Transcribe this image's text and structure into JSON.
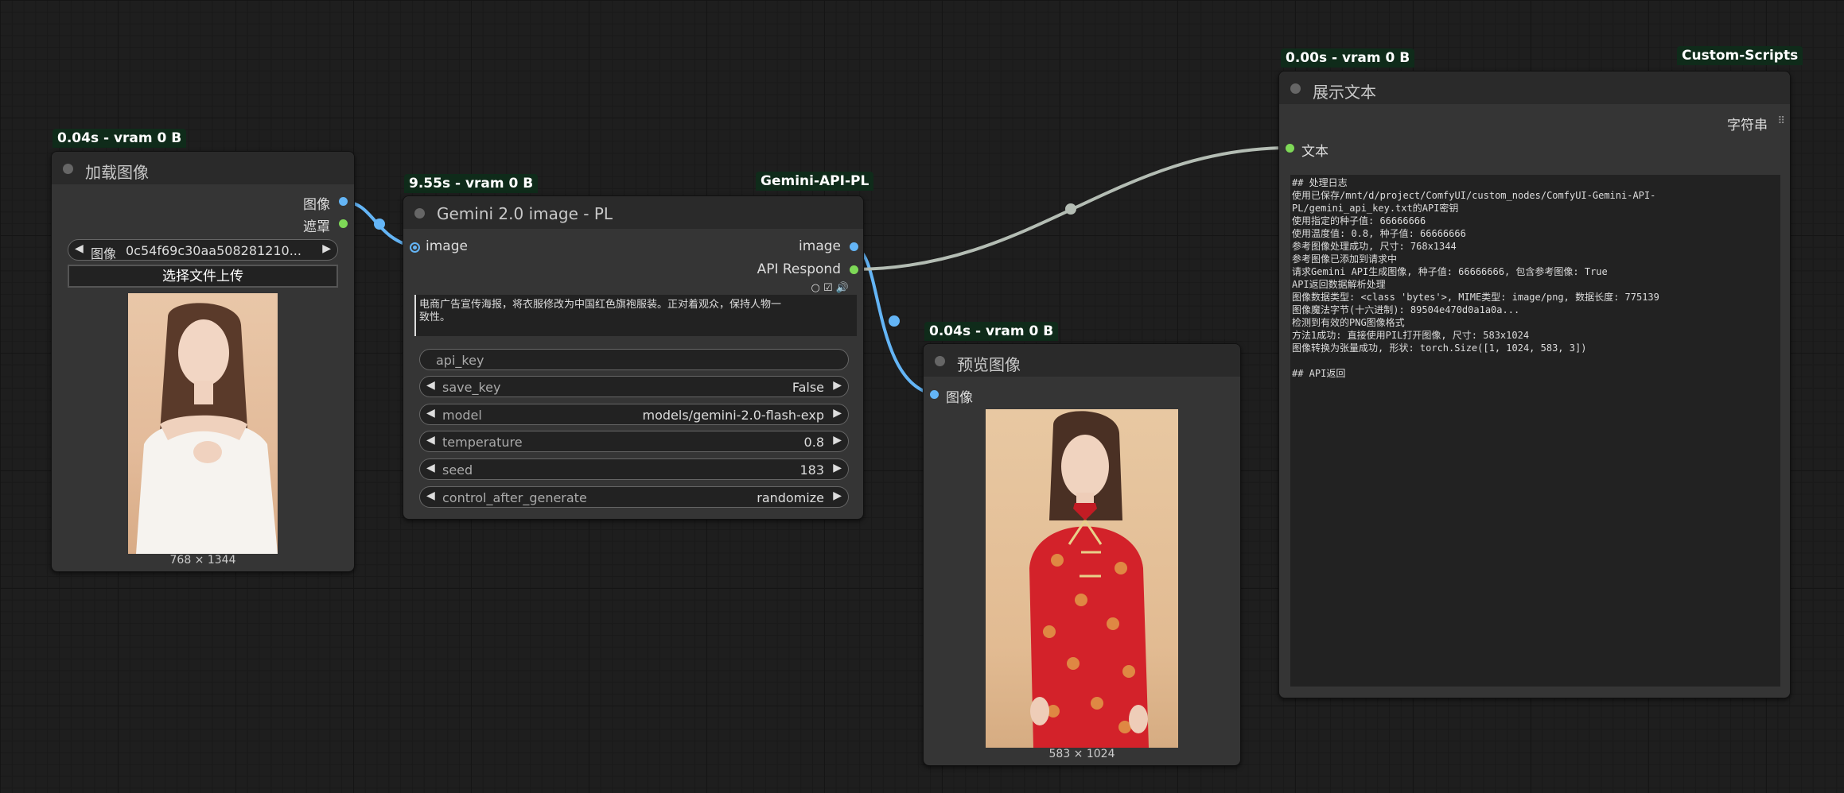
{
  "colors": {
    "canvas": "#1e1e1e",
    "node": "#353535",
    "header": "#2a2a2a",
    "badge": "#0f2b1a",
    "link_image": "#64b5f6",
    "link_string": "#b4bdb4",
    "port_green": "#7ed957"
  },
  "load_image_node": {
    "badge": "0.04s - vram 0 B",
    "title": "加载图像",
    "outputs": [
      "图像",
      "遮罩"
    ],
    "image_widget": {
      "label": "图像",
      "value": "0c54f69c30aa508281210..."
    },
    "upload_button": "选择文件上传",
    "image_desc": "woman-white-sweater-photo",
    "dimensions": "768 × 1344"
  },
  "gemini_node": {
    "badge": "9.55s - vram 0 B",
    "group_label": "Gemini-API-PL",
    "title": "Gemini 2.0 image - PL",
    "input": "image",
    "outputs": [
      "image",
      "API Respond"
    ],
    "prompt": "电商广告宣传海报，将衣服修改为中国红色旗袍服装。正对着观众，保持人物一\n致性。",
    "api_key_placeholder": "api_key",
    "widgets": [
      {
        "label": "save_key",
        "value": "False"
      },
      {
        "label": "model",
        "value": "models/gemini-2.0-flash-exp"
      },
      {
        "label": "temperature",
        "value": "0.8"
      },
      {
        "label": "seed",
        "value": "183"
      },
      {
        "label": "control_after_generate",
        "value": "randomize"
      }
    ]
  },
  "preview_node": {
    "badge": "0.04s - vram 0 B",
    "title": "预览图像",
    "input": "图像",
    "image_desc": "woman-red-qipao-photo",
    "dimensions": "583 × 1024"
  },
  "show_text_node": {
    "badge": "0.00s - vram 0 B",
    "group_label": "Custom-Scripts",
    "title": "展示文本",
    "output": "字符串",
    "input": "文本",
    "text": "## 处理日志\n使用已保存/mnt/d/project/ComfyUI/custom_nodes/ComfyUI-Gemini-API-\nPL/gemini_api_key.txt的API密钥\n使用指定的种子值: 66666666\n使用温度值: 0.8, 种子值: 66666666\n参考图像处理成功, 尺寸: 768x1344\n参考图像已添加到请求中\n请求Gemini API生成图像, 种子值: 66666666, 包含参考图像: True\nAPI返回数据解析处理\n图像数据类型: <class 'bytes'>, MIME类型: image/png, 数据长度: 775139\n图像魔法字节(十六进制): 89504e470d0a1a0a...\n检测到有效的PNG图像格式\n方法1成功: 直接使用PIL打开图像, 尺寸: 583x1024\n图像转换为张量成功, 形状: torch.Size([1, 1024, 583, 3])\n\n## API返回"
  }
}
